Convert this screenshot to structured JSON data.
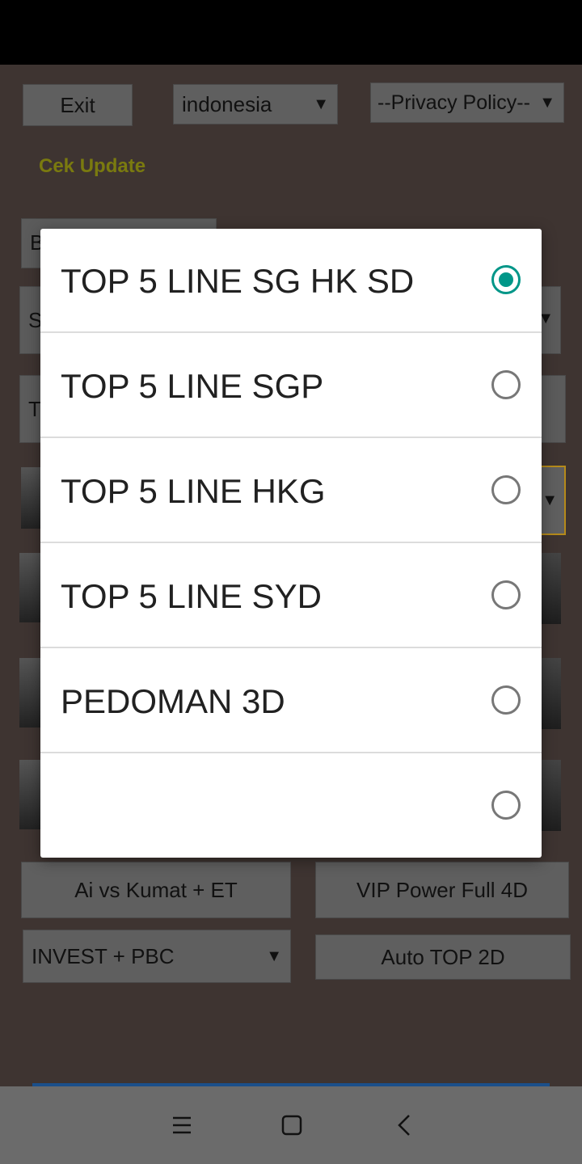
{
  "top": {
    "exit_label": "Exit",
    "language_value": "indonesia",
    "privacy_value": "--Privacy Policy--",
    "cek_update_label": "Cek Update"
  },
  "background_rows": {
    "row1_text": "B",
    "row2_text": "S",
    "row3_text": "T"
  },
  "bottom": {
    "ai_button": "Ai vs Kumat + ET",
    "vip_button": "VIP Power Full 4D",
    "invest_value": "INVEST + PBC",
    "auto_button": "Auto TOP 2D"
  },
  "dialog": {
    "options": [
      {
        "label": "TOP 5 LINE SG HK SD",
        "selected": true
      },
      {
        "label": "TOP 5 LINE SGP",
        "selected": false
      },
      {
        "label": "TOP 5 LINE HKG",
        "selected": false
      },
      {
        "label": "TOP 5 LINE SYD",
        "selected": false
      },
      {
        "label": "PEDOMAN 3D",
        "selected": false
      },
      {
        "label": "",
        "selected": false
      }
    ]
  },
  "colors": {
    "accent": "#009688",
    "cek_update": "#7a7a0f",
    "background": "#3e3431"
  },
  "navbar": {
    "icons": [
      "menu-icon",
      "home-square-icon",
      "back-chevron-icon"
    ]
  }
}
